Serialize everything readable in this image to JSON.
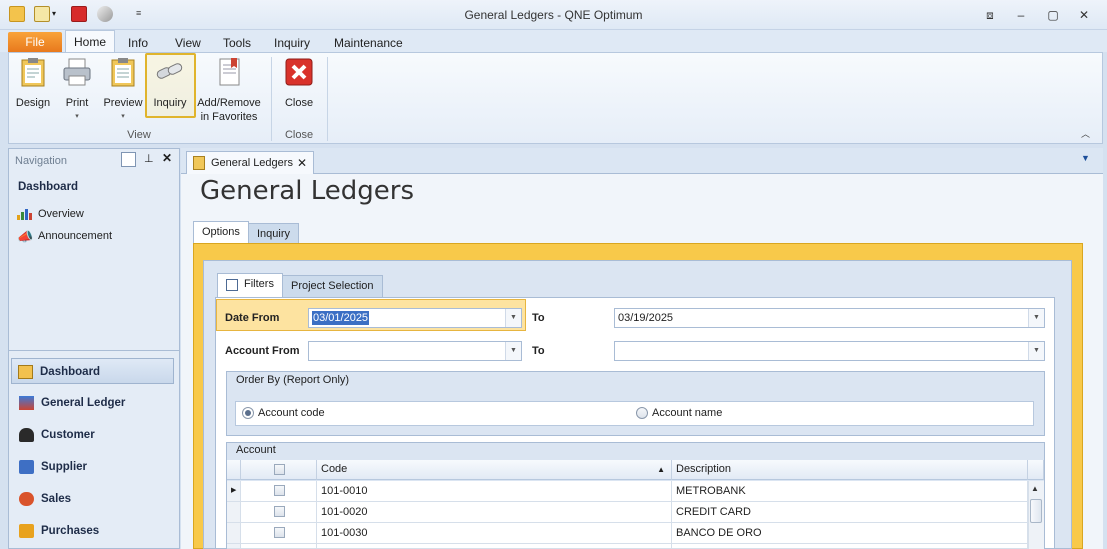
{
  "window": {
    "title": "General Ledgers - QNE Optimum"
  },
  "ribbon_tabs": [
    "File",
    "Home",
    "Info",
    "View",
    "Tools",
    "Inquiry",
    "Maintenance"
  ],
  "ribbon": {
    "design": "Design",
    "print": "Print",
    "preview": "Preview",
    "inquiry": "Inquiry",
    "add_remove_1": "Add/Remove",
    "add_remove_2": "in Favorites",
    "close": "Close",
    "group_view": "View",
    "group_close": "Close"
  },
  "nav": {
    "header": "Navigation",
    "dashboard_title": "Dashboard",
    "items": [
      "Overview",
      "Announcement"
    ],
    "buttons": [
      "Dashboard",
      "General Ledger",
      "Customer",
      "Supplier",
      "Sales",
      "Purchases"
    ]
  },
  "doc_tab": "General Ledgers",
  "page_title": "General Ledgers",
  "sub_tabs": [
    "Options",
    "Inquiry"
  ],
  "filter_tabs": [
    "Filters",
    "Project Selection"
  ],
  "filters": {
    "date_from_label": "Date From",
    "date_from": "03/01/2025",
    "to_label": "To",
    "date_to": "03/19/2025",
    "account_from_label": "Account From",
    "account_to_label": "To"
  },
  "order_by": {
    "title": "Order By (Report Only)",
    "opt1": "Account code",
    "opt2": "Account name"
  },
  "account_grid": {
    "title": "Account",
    "columns": [
      "Code",
      "Description"
    ],
    "rows": [
      {
        "code": "101-0010",
        "desc": "METROBANK"
      },
      {
        "code": "101-0020",
        "desc": "CREDIT CARD"
      },
      {
        "code": "101-0030",
        "desc": "BANCO DE ORO"
      }
    ]
  },
  "colors": {
    "accent": "#f8c94a",
    "file_tab": "#e8791d",
    "close_red": "#d9322b"
  }
}
